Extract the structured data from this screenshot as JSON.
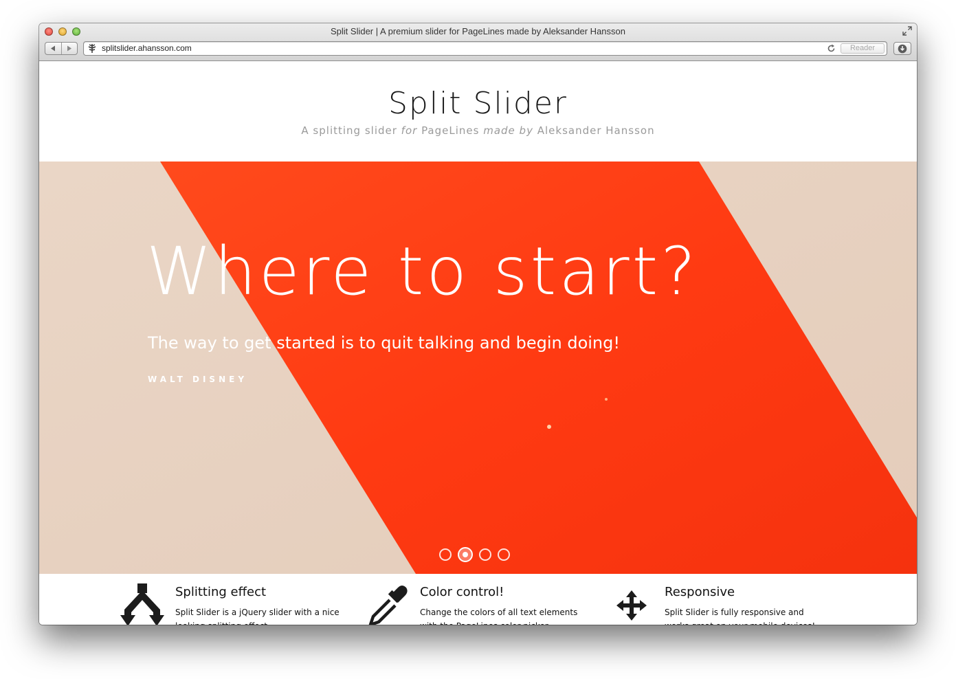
{
  "window": {
    "title": "Split Slider | A premium slider for PageLines made by Aleksander Hansson",
    "url": "splitslider.ahansson.com",
    "reader_label": "Reader"
  },
  "header": {
    "title": "Split Slider",
    "subtitle_1": "A splitting slider ",
    "subtitle_em1": "for",
    "subtitle_2": " PageLines ",
    "subtitle_em2": "made by",
    "subtitle_3": " Aleksander Hansson"
  },
  "slide": {
    "heading": "Where to start?",
    "quote": "The way to get started is to quit talking and begin doing!",
    "author": "WALT DISNEY",
    "current_index": 2,
    "total": 4,
    "colors": {
      "background": "#e8d3c2",
      "band": "#ff3a12"
    }
  },
  "features": [
    {
      "icon": "split-arrows-icon",
      "title": "Splitting effect",
      "text": "Split Slider is a jQuery slider with a nice looking splitting effect."
    },
    {
      "icon": "eyedropper-icon",
      "title": "Color control!",
      "text": "Change the colors of all text elements with the PageLines color picker."
    },
    {
      "icon": "move-arrows-icon",
      "title": "Responsive",
      "text": "Split Slider is fully responsive and works great on your mobile devices!"
    }
  ]
}
